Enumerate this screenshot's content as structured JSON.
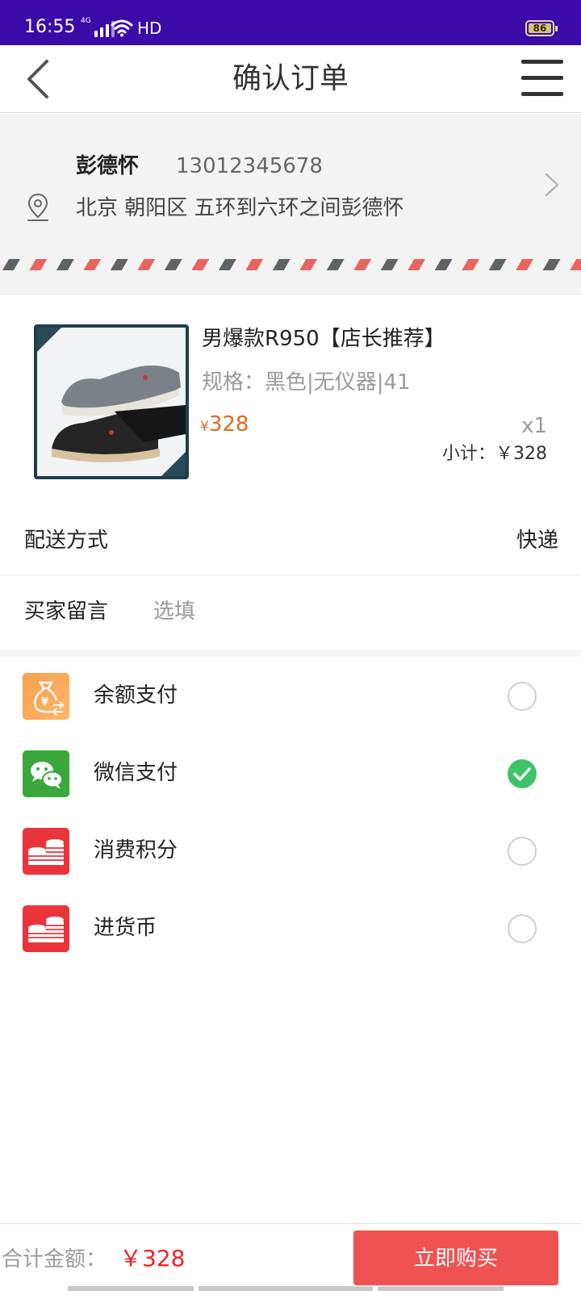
{
  "status_bar": {
    "time": "16:55",
    "network": "4G",
    "hd": "HD",
    "battery": "86"
  },
  "header": {
    "title": "确认订单",
    "back_icon": "chevron-left-icon",
    "menu_icon": "hamburger-menu-icon"
  },
  "address": {
    "name": "彭德怀",
    "phone": "13012345678",
    "detail": "北京 朝阳区 五环到六环之间彭德怀",
    "stripe_colors": [
      "#e8655f",
      "#5e6466"
    ]
  },
  "product": {
    "name": "男爆款R950【店长推荐】",
    "spec": "规格：黑色|无仪器|41",
    "price_symbol": "¥",
    "price": "328",
    "quantity": "x1",
    "subtotal": "小计：￥328",
    "price_color": "#e06a22"
  },
  "delivery": {
    "label": "配送方式",
    "value": "快递"
  },
  "message": {
    "label": "买家留言",
    "placeholder": "选填"
  },
  "payment_options": [
    {
      "label": "余额支付",
      "icon": "money-bag-icon",
      "selected": false
    },
    {
      "label": "微信支付",
      "icon": "wechat-icon",
      "selected": true
    },
    {
      "label": "消费积分",
      "icon": "coins-icon",
      "selected": false
    },
    {
      "label": "进货币",
      "icon": "coins-icon",
      "selected": false
    }
  ],
  "footer": {
    "total_label": "合计金额：",
    "total_value": "￥328",
    "buy_button": "立即购买",
    "accent_color": "#ef5252"
  }
}
